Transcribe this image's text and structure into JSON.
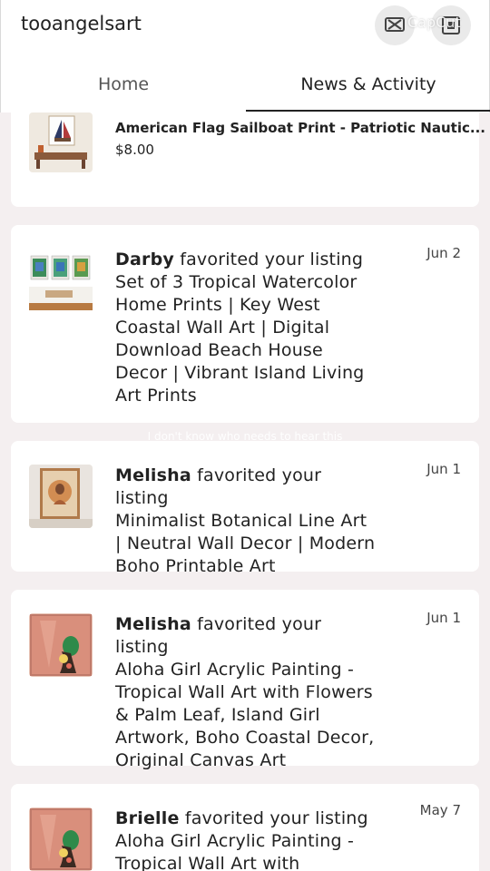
{
  "header": {
    "shop_name": "tooangelsart",
    "watermark": "CapCut"
  },
  "tabs": [
    {
      "label": "Home",
      "active": false
    },
    {
      "label": "News & Activity",
      "active": true
    }
  ],
  "caption_overlay": "I don't know who needs to hear this",
  "feed": {
    "listing_card": {
      "title": "American Flag Sailboat Print - Patriotic Nautic...",
      "price": "$8.00"
    },
    "activities": [
      {
        "user": "Darby",
        "action": " favorited your listing",
        "listing": "Set of 3 Tropical Watercolor Home Prints | Key West Coastal Wall Art | Digital Download Beach House Decor | Vibrant Island Living Art Prints",
        "date": "Jun 2"
      },
      {
        "user": "Melisha",
        "action": " favorited your listing",
        "listing": "Minimalist Botanical Line Art | Neutral Wall Decor | Modern Boho Printable Art",
        "date": "Jun 1"
      },
      {
        "user": "Melisha",
        "action": " favorited your listing",
        "listing": "Aloha Girl Acrylic Painting - Tropical Wall Art with Flowers & Palm Leaf, Island Girl Artwork, Boho Coastal Decor, Original Canvas Art",
        "date": "Jun 1"
      },
      {
        "user": "Brielle",
        "action": " favorited your listing",
        "listing": "Aloha Girl Acrylic Painting - Tropical Wall Art with",
        "date": "May 7"
      }
    ]
  },
  "colors": {
    "background": "#f4eff0",
    "card": "#ffffff",
    "text": "#222222"
  }
}
